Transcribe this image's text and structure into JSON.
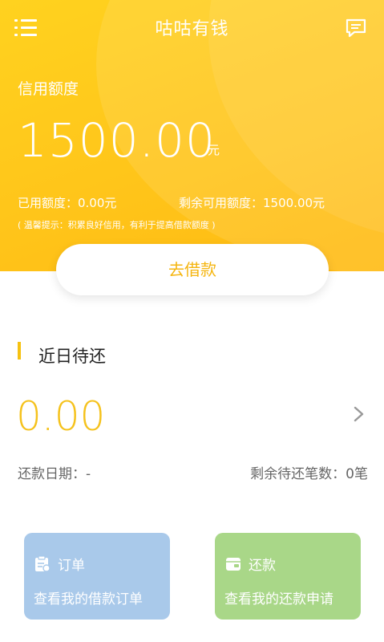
{
  "header": {
    "title": "咕咕有钱",
    "menu_icon": "menu-icon",
    "message_icon": "message-icon",
    "background": "#ffc51a"
  },
  "credit": {
    "label": "信用额度",
    "amount": "1500.00",
    "unit": "元",
    "used": "已用额度：0.00元",
    "remaining": "剩余可用额度：1500.00元",
    "tip": "( 温馨提示：积累良好信用，有利于提高借款额度 )"
  },
  "borrow_button": "去借款",
  "recent_due": {
    "title": "近日待还",
    "amount": "0.00",
    "repay_date": "还款日期：-",
    "remaining_count": "剩余待还笔数：0笔"
  },
  "cards": {
    "orders": {
      "title": "订单",
      "desc": "查看我的借款订单",
      "icon": "clipboard-icon",
      "color": "#a9c9ea"
    },
    "repay": {
      "title": "还款",
      "desc": "查看我的还款申请",
      "icon": "wallet-icon",
      "color": "#a9d788"
    }
  },
  "accent": "#f5c21c"
}
